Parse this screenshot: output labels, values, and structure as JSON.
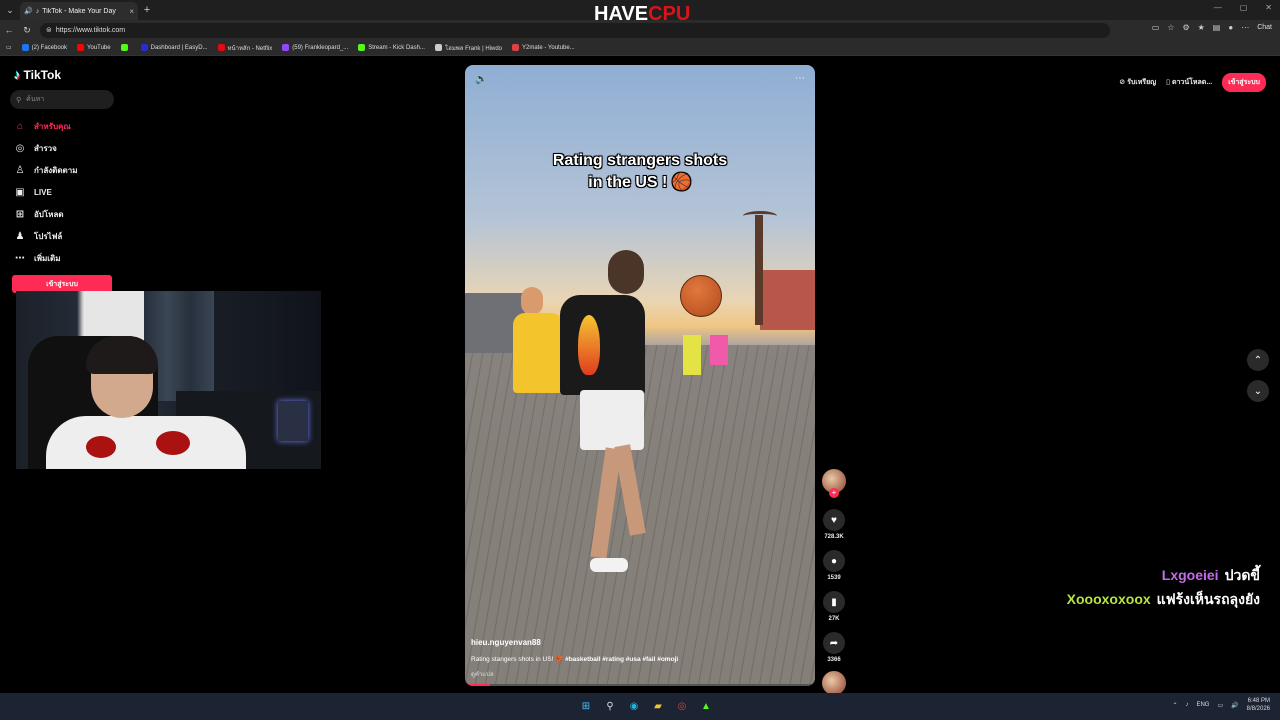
{
  "browser": {
    "tab_title": "TikTok - Make Your Day",
    "new_tab": "+",
    "url": "https://www.tiktok.com",
    "chat_label": "Chat",
    "bookmarks": [
      {
        "label": "(2) Facebook",
        "color": "#1877f2"
      },
      {
        "label": "YouTube",
        "color": "#ff0000"
      },
      {
        "label": "",
        "color": "#53fc18"
      },
      {
        "label": "Dashboard | EasyD...",
        "color": "#2b2bd6"
      },
      {
        "label": "หน้าหลัก - Netflix",
        "color": "#e50914"
      },
      {
        "label": "(59) Frankleopard_...",
        "color": "#9146ff"
      },
      {
        "label": "Stream - Kick Dash...",
        "color": "#53fc18"
      },
      {
        "label": "โฮมพล Frank | Hiwdo",
        "color": "#cccccc"
      },
      {
        "label": "Y2mate - Youtube...",
        "color": "#e04040"
      }
    ]
  },
  "overlay_brand": {
    "part1": "HAVE",
    "part2": "CPU"
  },
  "tiktok": {
    "logo": "TikTok",
    "search_placeholder": "ค้นหา",
    "nav": [
      {
        "label": "สำหรับคุณ",
        "icon": "home-icon",
        "glyph": "⌂",
        "active": true
      },
      {
        "label": "สำรวจ",
        "icon": "compass-icon",
        "glyph": "◎",
        "active": false
      },
      {
        "label": "กำลังติดตาม",
        "icon": "following-icon",
        "glyph": "♙",
        "active": false
      },
      {
        "label": "LIVE",
        "icon": "live-icon",
        "glyph": "▣",
        "active": false
      },
      {
        "label": "อัปโหลด",
        "icon": "upload-icon",
        "glyph": "⊞",
        "active": false
      },
      {
        "label": "โปรไฟล์",
        "icon": "profile-icon",
        "glyph": "♟",
        "active": false
      },
      {
        "label": "เพิ่มเติม",
        "icon": "more-icon",
        "glyph": "⋯",
        "active": false
      }
    ],
    "login_label": "เข้าสู่ระบบ",
    "top_right": {
      "rewards": "รับเหรียญ",
      "download": "ดาวน์โหลด...",
      "login": "เข้าสู่ระบบ"
    }
  },
  "video": {
    "caption_line1": "Rating strangers shots",
    "caption_line2": "in the US ! 🏀",
    "author": "hieu.nguyenvan88",
    "description": "Rating stangers shots in US! 🏀",
    "hashtags": "#basketball #rating #usa #fail #omoji",
    "translate": "ดูคำแปล",
    "progress_fraction": 0.07,
    "likes": "728.3K",
    "comments": "1539",
    "saves": "27K",
    "shares": "3366"
  },
  "stream_chat": [
    {
      "user": "Lxgoeiei",
      "message": "ปวดขี้"
    },
    {
      "user": "Xoooxoxoox",
      "message": "แฟร้งเห็นรถลุงยัง"
    }
  ],
  "taskbar": {
    "lang": "ENG",
    "time": "6:48 PM",
    "date": "8/8/2026"
  }
}
